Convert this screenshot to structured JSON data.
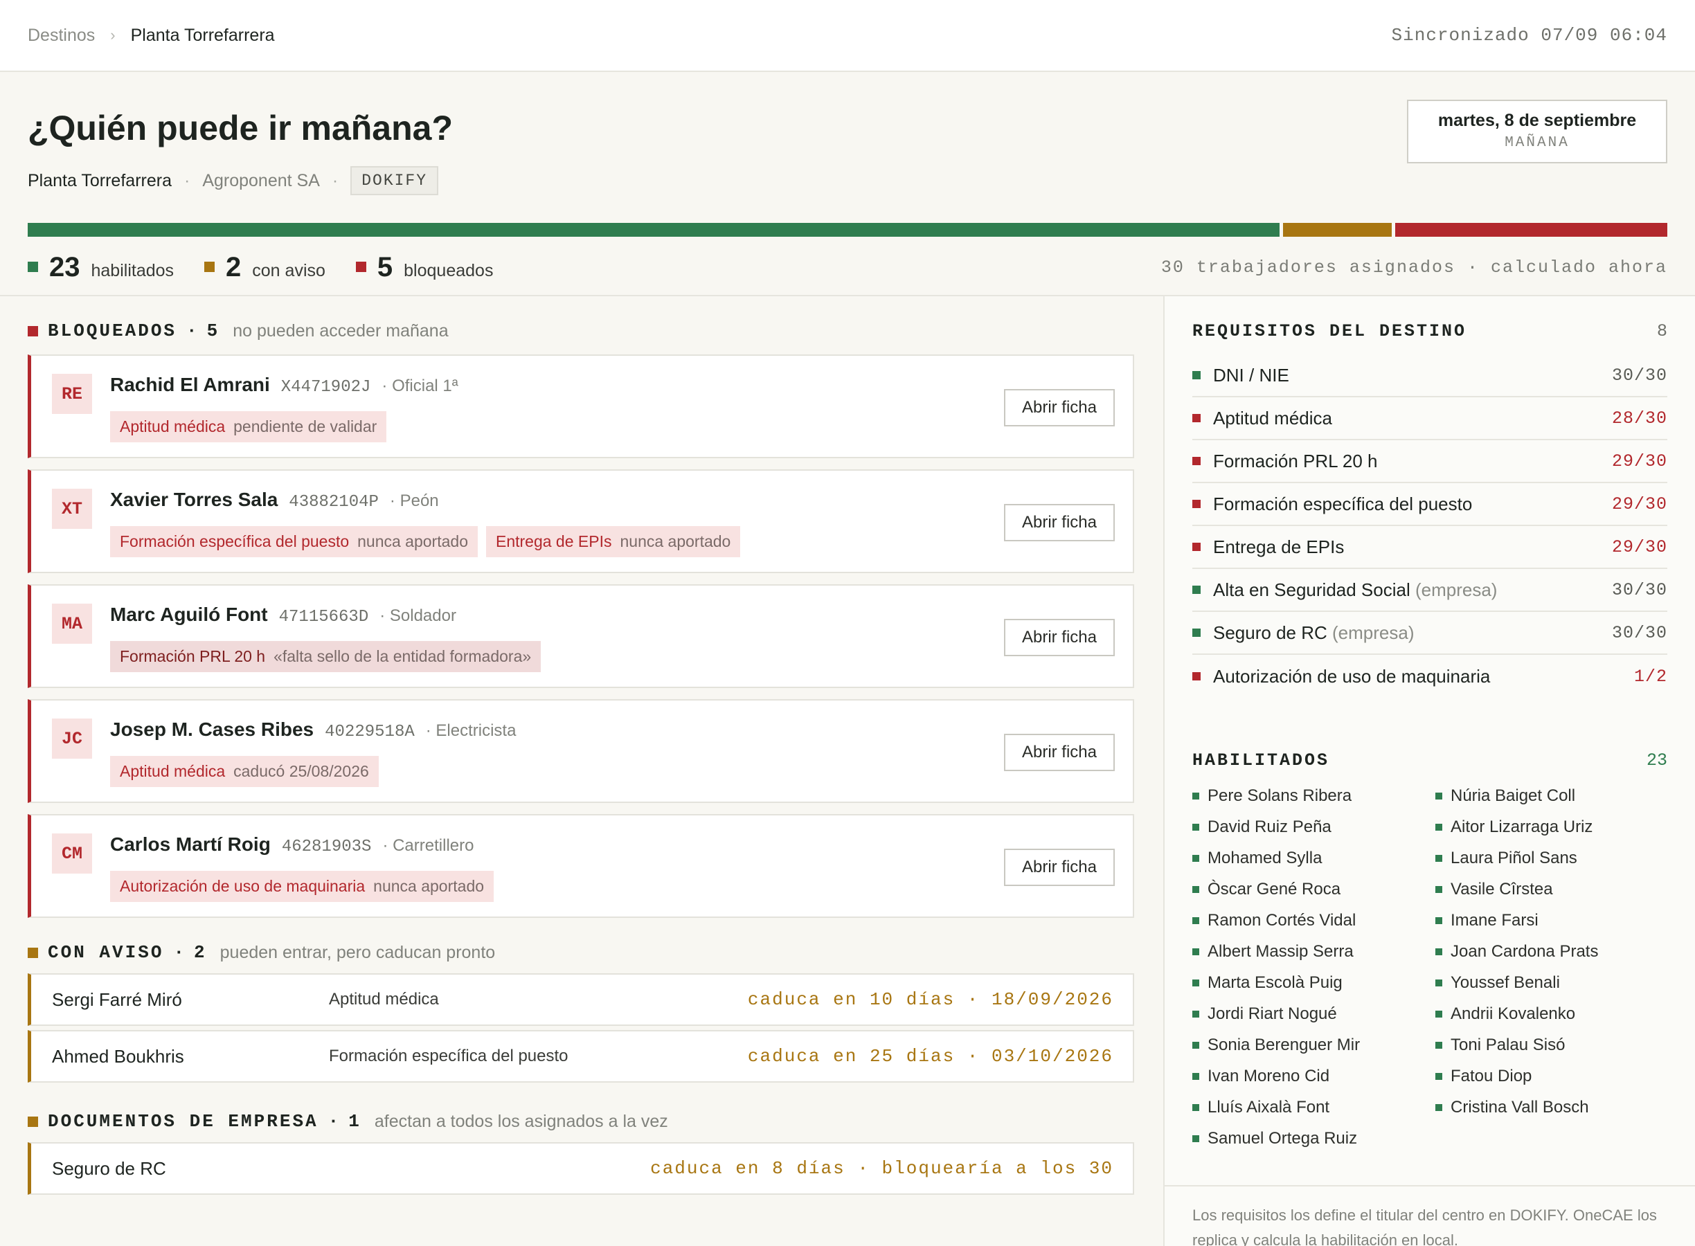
{
  "breadcrumb": {
    "root": "Destinos",
    "current": "Planta Torrefarrera"
  },
  "sync_status": "Sincronizado 07/09 06:04",
  "header": {
    "title": "¿Quién puede ir mañana?",
    "site": "Planta Torrefarrera",
    "company": "Agroponent SA",
    "source_tag": "DOKIFY",
    "date": "martes, 8 de septiembre",
    "date_label": "MAÑANA"
  },
  "summary": {
    "enabled_count": "23",
    "enabled_label": "habilitados",
    "warning_count": "2",
    "warning_label": "con aviso",
    "blocked_count": "5",
    "blocked_label": "bloqueados",
    "meta": "30 trabajadores asignados · calculado ahora",
    "total": 30,
    "enabled_value": 23,
    "warning_value": 2,
    "blocked_value": 5
  },
  "colors": {
    "green": "#2f7d4f",
    "amber": "#a87612",
    "red": "#b2282d"
  },
  "blocked": {
    "title": "BLOQUEADOS",
    "dot": "·",
    "count": "5",
    "desc": "no pueden acceder mañana",
    "items": [
      {
        "initials": "RE",
        "name": "Rachid El Amrani",
        "id": "X4471902J",
        "role": "· Oficial 1ª",
        "issues": [
          {
            "req": "Aptitud médica",
            "status": "pendiente de validar"
          }
        ]
      },
      {
        "initials": "XT",
        "name": "Xavier Torres Sala",
        "id": "43882104P",
        "role": "· Peón",
        "issues": [
          {
            "req": "Formación específica del puesto",
            "status": "nunca aportado"
          },
          {
            "req": "Entrega de EPIs",
            "status": "nunca aportado"
          }
        ]
      },
      {
        "initials": "MA",
        "name": "Marc Aguiló Font",
        "id": "47115663D",
        "role": "· Soldador",
        "issues": [
          {
            "req": "Formación PRL 20 h",
            "status": "«falta sello de la entidad formadora»"
          }
        ]
      },
      {
        "initials": "JC",
        "name": "Josep M. Cases Ribes",
        "id": "40229518A",
        "role": "· Electricista",
        "issues": [
          {
            "req": "Aptitud médica",
            "status": "caducó 25/08/2026"
          }
        ]
      },
      {
        "initials": "CM",
        "name": "Carlos Martí Roig",
        "id": "46281903S",
        "role": "· Carretillero",
        "issues": [
          {
            "req": "Autorización de uso de maquinaria",
            "status": "nunca aportado"
          }
        ]
      }
    ],
    "open_label": "Abrir ficha"
  },
  "warnings": {
    "title": "CON AVISO",
    "dot": "·",
    "count": "2",
    "desc": "pueden entrar, pero caducan pronto",
    "items": [
      {
        "name": "Sergi Farré Miró",
        "req": "Aptitud médica",
        "when": "caduca en 10 días · 18/09/2026"
      },
      {
        "name": "Ahmed Boukhris",
        "req": "Formación específica del puesto",
        "when": "caduca en 25 días · 03/10/2026"
      }
    ]
  },
  "company_docs": {
    "title": "DOCUMENTOS DE EMPRESA",
    "dot": "·",
    "count": "1",
    "desc": "afectan a todos los asignados a la vez",
    "items": [
      {
        "name": "Seguro de RC",
        "when": "caduca en 8 días · bloquearía a los 30"
      }
    ]
  },
  "requirements": {
    "title": "REQUISITOS DEL DESTINO",
    "count": "8",
    "items": [
      {
        "name": "DNI / NIE",
        "extra": "",
        "value": "30/30",
        "status": "ok"
      },
      {
        "name": "Aptitud médica",
        "extra": "",
        "value": "28/30",
        "status": "fail"
      },
      {
        "name": "Formación PRL 20 h",
        "extra": "",
        "value": "29/30",
        "status": "fail"
      },
      {
        "name": "Formación específica del puesto",
        "extra": "",
        "value": "29/30",
        "status": "fail"
      },
      {
        "name": "Entrega de EPIs",
        "extra": "",
        "value": "29/30",
        "status": "fail"
      },
      {
        "name": "Alta en Seguridad Social",
        "extra": "(empresa)",
        "value": "30/30",
        "status": "ok"
      },
      {
        "name": "Seguro de RC",
        "extra": "(empresa)",
        "value": "30/30",
        "status": "ok"
      },
      {
        "name": "Autorización de uso de maquinaria",
        "extra": "",
        "value": "1/2",
        "status": "fail"
      }
    ]
  },
  "enabled": {
    "title": "HABILITADOS",
    "count": "23",
    "names": [
      "Pere Solans Ribera",
      "Núria Baiget Coll",
      "David Ruiz Peña",
      "Aitor Lizarraga Uriz",
      "Mohamed Sylla",
      "Laura Piñol Sans",
      "Òscar Gené Roca",
      "Vasile Cîrstea",
      "Ramon Cortés Vidal",
      "Imane Farsi",
      "Albert Massip Serra",
      "Joan Cardona Prats",
      "Marta Escolà Puig",
      "Youssef Benali",
      "Jordi Riart Nogué",
      "Andrii Kovalenko",
      "Sonia Berenguer Mir",
      "Toni Palau Sisó",
      "Ivan Moreno Cid",
      "Fatou Diop",
      "Lluís Aixalà Font",
      "Cristina Vall Bosch",
      "Samuel Ortega Ruiz"
    ]
  },
  "footnote": "Los requisitos los define el titular del centro en DOKIFY. OneCAE los replica y calcula la habilitación en local."
}
